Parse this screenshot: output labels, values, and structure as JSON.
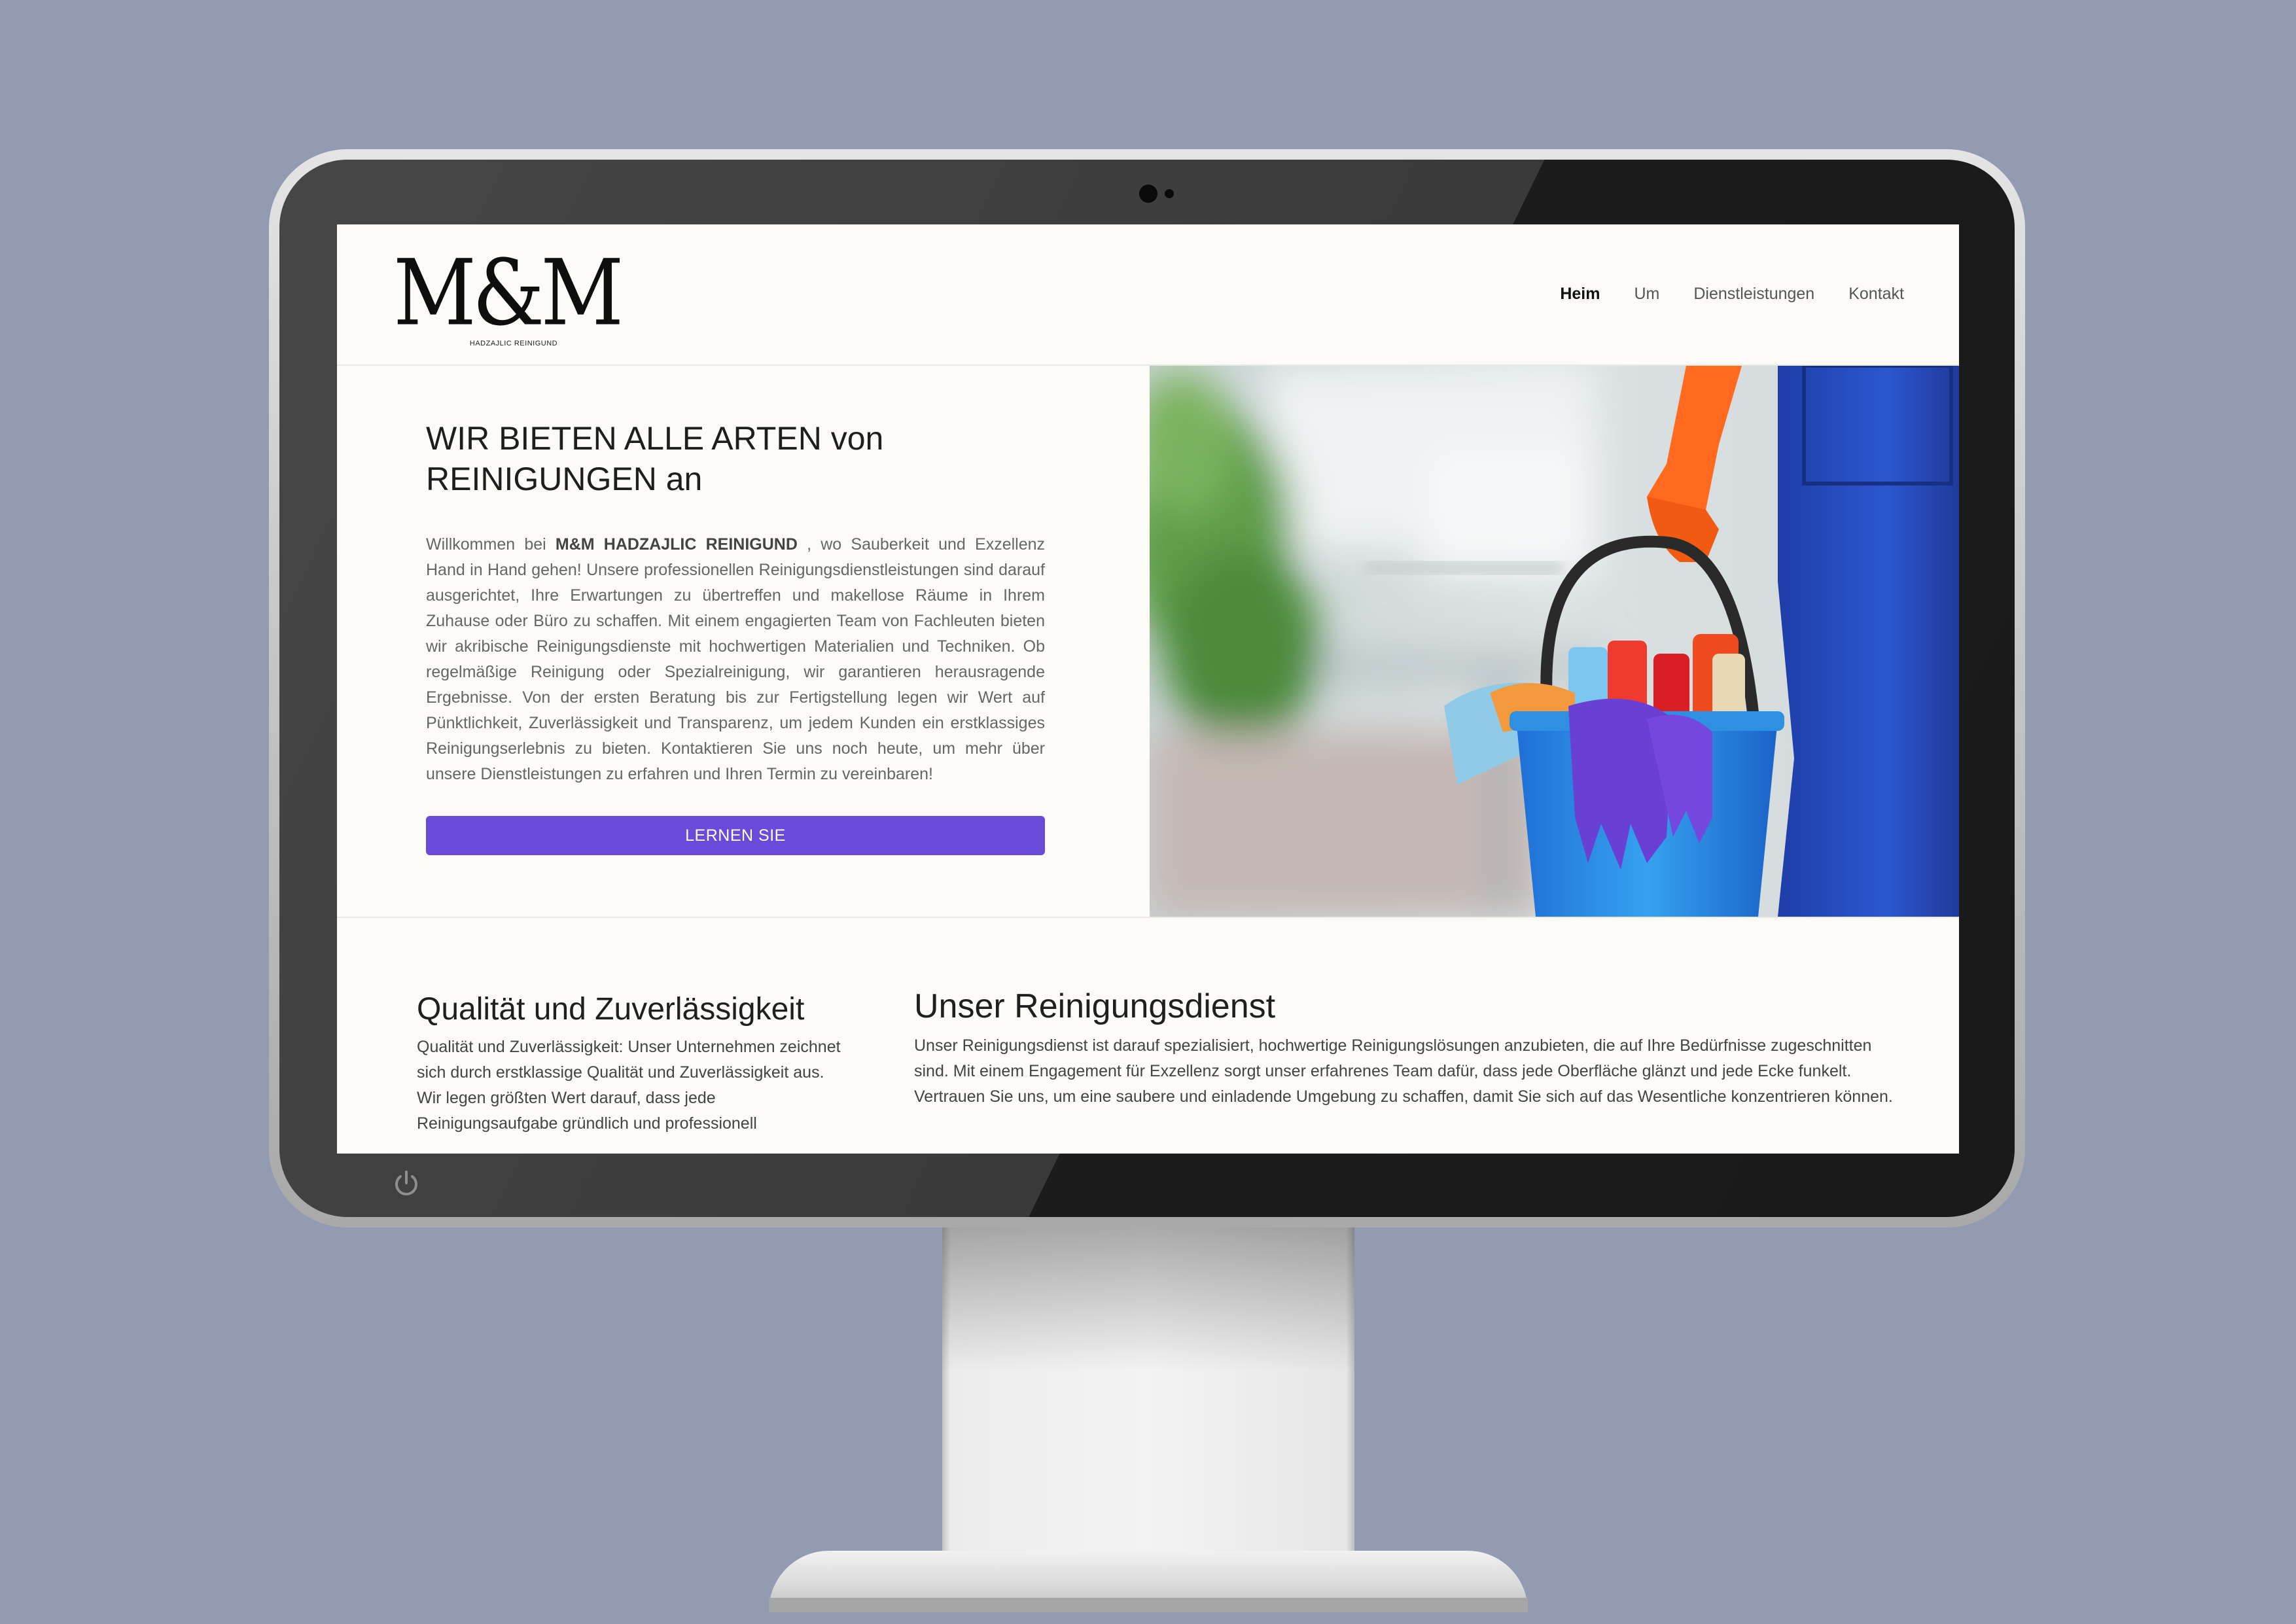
{
  "header": {
    "logo_text": "M&M",
    "logo_tagline": "HADZAJLIC REINIGUND",
    "nav": [
      {
        "label": "Heim",
        "active": true
      },
      {
        "label": "Um",
        "active": false
      },
      {
        "label": "Dienstleistungen",
        "active": false
      },
      {
        "label": "Kontakt",
        "active": false
      }
    ]
  },
  "hero": {
    "title_line1": "WIR BIETEN ALLE ARTEN von",
    "title_line2": "REINIGUNGEN an",
    "intro_before": "Willkommen bei ",
    "intro_brand": "M&M HADZAJLIC REINIGUND",
    "intro_after": " , wo Sauberkeit und Exzellenz Hand in Hand gehen! Unsere professionellen Reinigungsdienstleistungen sind darauf ausgerichtet, Ihre Erwartungen zu übertreffen und makellose Räume in Ihrem Zuhause oder Büro zu schaffen. Mit einem engagierten Team von Fachleuten bieten wir akribische Reinigungsdienste mit hochwertigen Materialien und Techniken. Ob regelmäßige Reinigung oder Spezialreinigung, wir garantieren herausragende Ergebnisse. Von der ersten Beratung bis zur Fertigstellung legen wir Wert auf Pünktlichkeit, Zuverlässigkeit und Transparenz, um jedem Kunden ein erstklassiges Reinigungserlebnis zu bieten. Kontaktieren Sie uns noch heute, um mehr über unsere Dienstleistungen zu erfahren und Ihren Termin zu vereinbaren!",
    "button_label": "LERNEN SIE"
  },
  "features": {
    "quality": {
      "title": "Qualität und Zuverlässigkeit",
      "text": "Qualität und Zuverlässigkeit: Unser Unternehmen zeichnet sich durch erstklassige Qualität und Zuverlässigkeit aus. Wir legen größten Wert darauf, dass jede Reinigungsaufgabe gründlich und professionell"
    },
    "service": {
      "title": "Unser Reinigungsdienst",
      "text": "Unser Reinigungsdienst ist darauf spezialisiert, hochwertige Reinigungslösungen anzubieten, die auf Ihre Bedürfnisse zugeschnitten sind. Mit einem Engagement für Exzellenz sorgt unser erfahrenes Team dafür, dass jede Oberfläche glänzt und jede Ecke funkelt. Vertrauen Sie uns, um eine saubere und einladende Umgebung zu schaffen, damit Sie sich auf das Wesentliche konzentrieren können."
    }
  },
  "icons": {
    "power": "power-icon",
    "webcam": "webcam-icon"
  },
  "colors": {
    "accent": "#6a4bd9",
    "page_background": "#929bb2",
    "screen_background": "#fcfbf7"
  }
}
